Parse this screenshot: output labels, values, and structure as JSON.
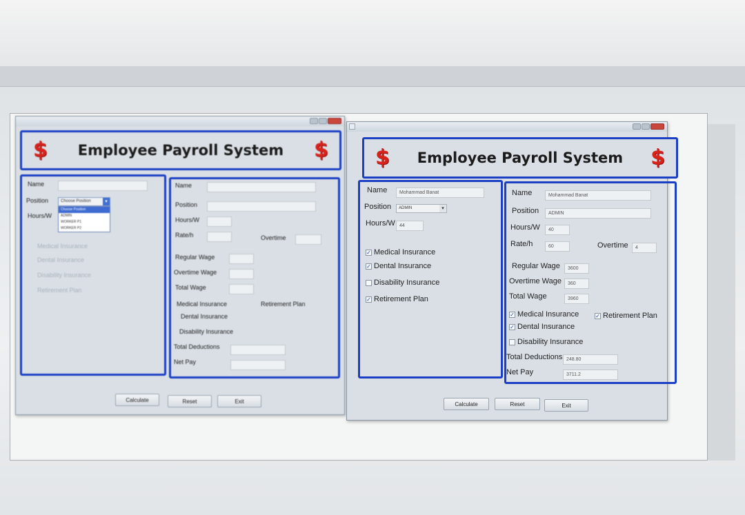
{
  "app_title": "Employee Payroll System",
  "currency_symbol": "$",
  "colors": {
    "frame_blue": "#1a3fc4",
    "dollar_red": "#d8231c",
    "close_red": "#c9463d"
  },
  "icons": [
    "dollar-icon",
    "checkbox-checked-icon",
    "checkbox-empty-icon",
    "dropdown-arrow-icon"
  ],
  "labels": {
    "name": "Name",
    "position": "Position",
    "hours": "Hours/W",
    "rate": "Rate/h",
    "overtime": "Overtime",
    "regular_wage": "Regular Wage",
    "overtime_wage": "Overtime Wage",
    "total_wage": "Total Wage",
    "medical": "Medical Insurance",
    "dental": "Dental Insurance",
    "disability": "Disability Insurance",
    "retirement": "Retirement Plan",
    "total_deductions": "Total Deductions",
    "net_pay": "Net Pay"
  },
  "buttons": {
    "calculate": "Calculate",
    "reset": "Reset",
    "exit": "Exit"
  },
  "left_window": {
    "position_combo": "Choose Position",
    "position_options": [
      "Choose Position",
      "ADMIN",
      "WORKER P1",
      "WORKER P2"
    ],
    "selected_option_index": 0
  },
  "right_window": {
    "input": {
      "name": "Mohammad Banat",
      "position": "ADMIN",
      "hours": "44",
      "medical": true,
      "dental": true,
      "disability": false,
      "retirement": true
    },
    "output": {
      "name": "Mohammad Banat",
      "position": "ADMIN",
      "hours": "40",
      "rate": "60",
      "overtime": "4",
      "regular_wage": "3600",
      "overtime_wage": "360",
      "total_wage": "3960",
      "medical": true,
      "dental": true,
      "disability": false,
      "retirement": true,
      "total_deductions": "248.80",
      "net_pay": "3711.2"
    }
  }
}
